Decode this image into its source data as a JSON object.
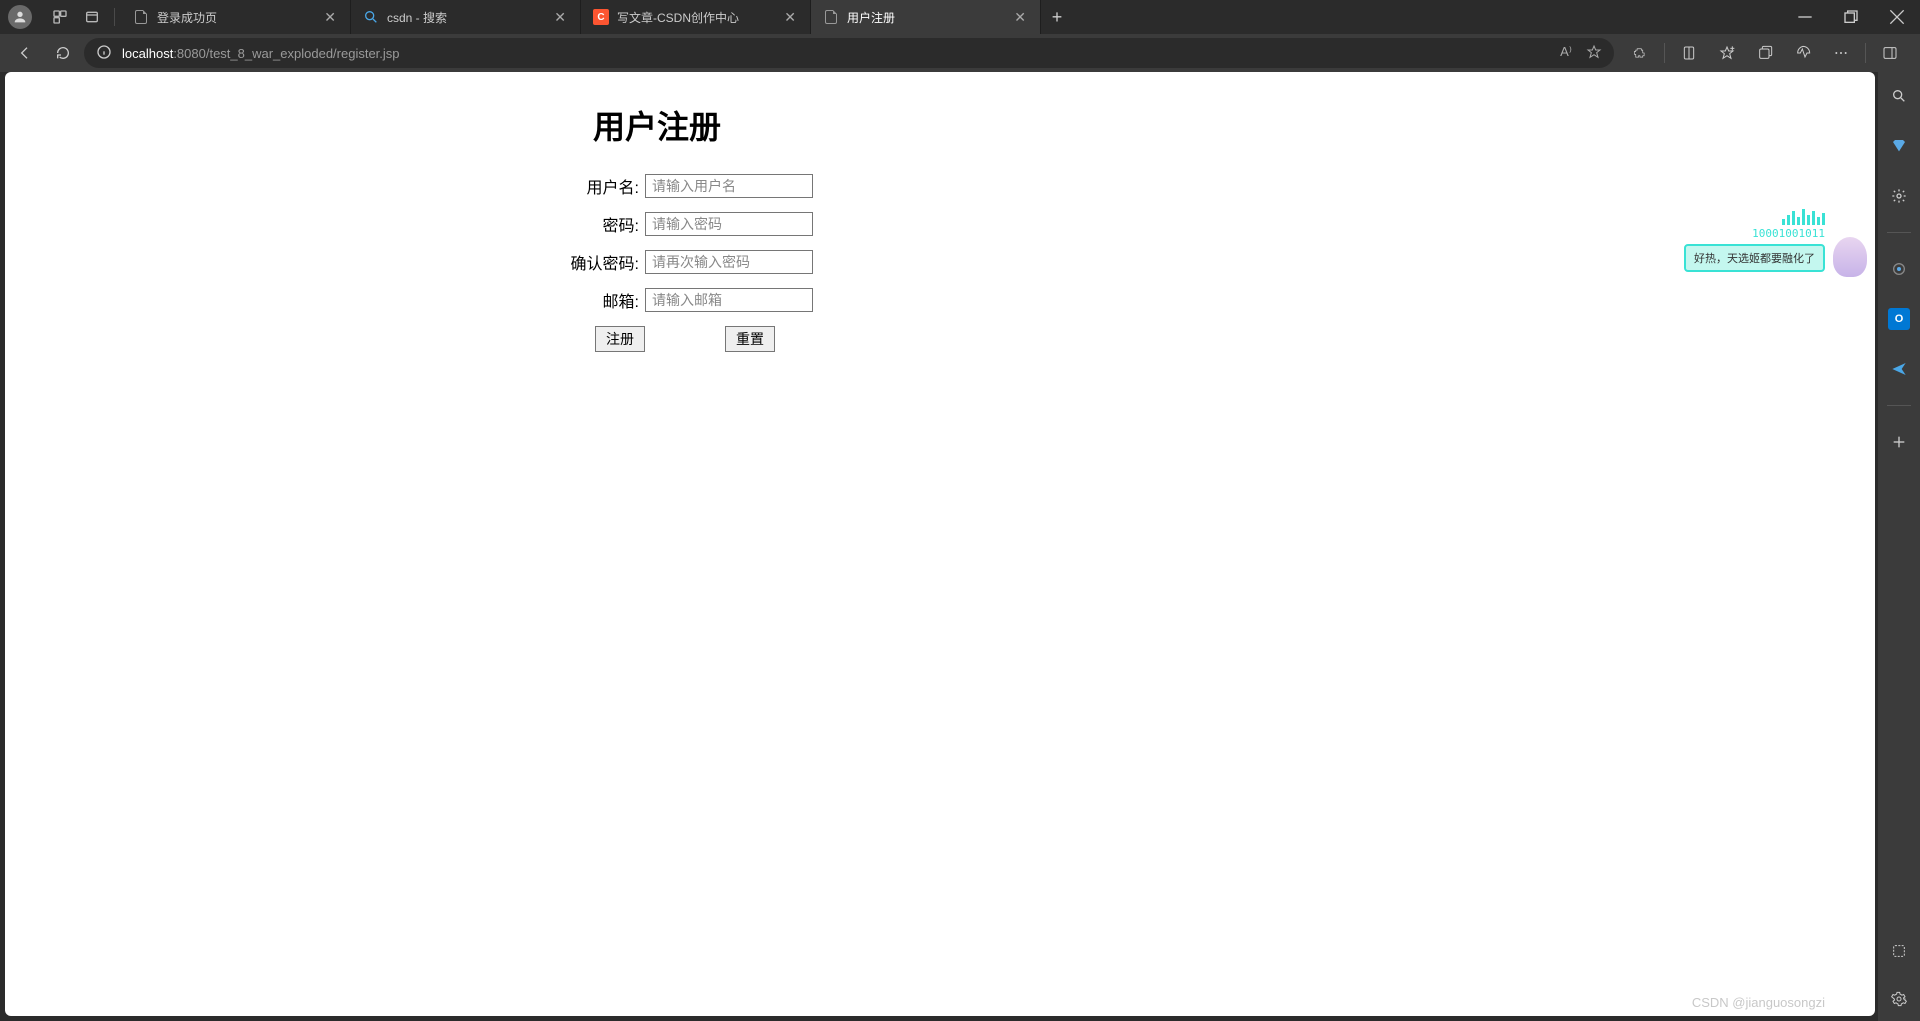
{
  "titlebar": {
    "tabs": [
      {
        "title": "登录成功页",
        "favicon": "page"
      },
      {
        "title": "csdn - 搜索",
        "favicon": "search"
      },
      {
        "title": "写文章-CSDN创作中心",
        "favicon": "csdn"
      },
      {
        "title": "用户注册",
        "favicon": "page",
        "active": true
      }
    ]
  },
  "addressbar": {
    "host": "localhost",
    "path": ":8080/test_8_war_exploded/register.jsp"
  },
  "page": {
    "heading": "用户注册",
    "fields": {
      "username": {
        "label": "用户名:",
        "placeholder": "请输入用户名"
      },
      "password": {
        "label": "密码:",
        "placeholder": "请输入密码"
      },
      "confirm": {
        "label": "确认密码:",
        "placeholder": "请再次输入密码"
      },
      "email": {
        "label": "邮箱:",
        "placeholder": "请输入邮箱"
      }
    },
    "buttons": {
      "submit": "注册",
      "reset": "重置"
    }
  },
  "widget": {
    "digits": "10001001011",
    "bubble": "好热，天选姬都要融化了"
  },
  "watermark": "CSDN @jianguosongzi"
}
